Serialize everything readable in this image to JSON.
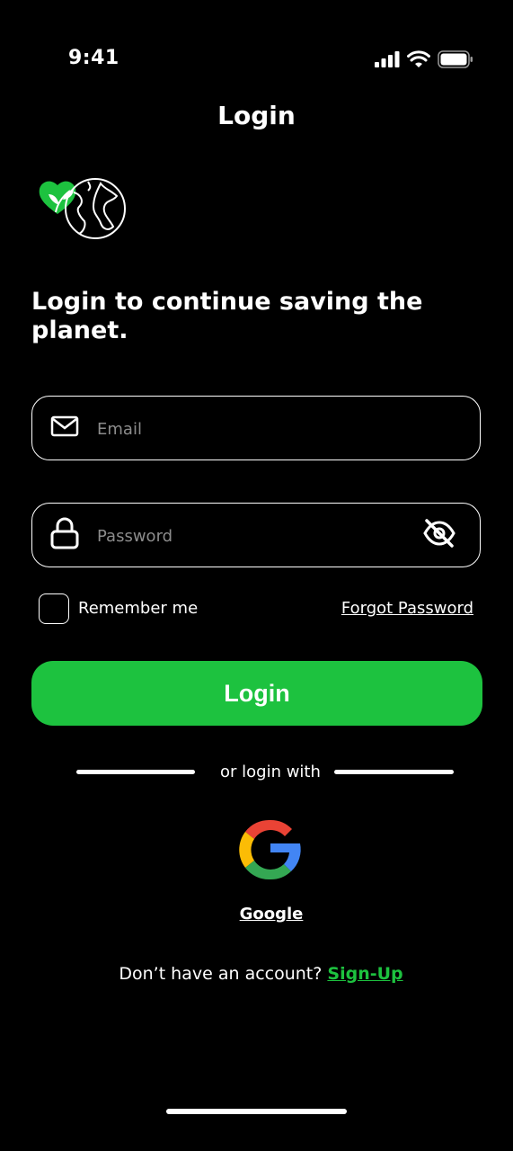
{
  "status_bar": {
    "time": "9:41"
  },
  "header": {
    "title": "Login"
  },
  "headline": "Login to continue saving the planet.",
  "email": {
    "placeholder": "Email",
    "value": ""
  },
  "password": {
    "placeholder": "Password",
    "value": ""
  },
  "remember": {
    "label": "Remember me",
    "checked": false
  },
  "forgot_label": "Forgot Password",
  "login_button_label": "Login",
  "divider_text": "or login with",
  "google_label": "Google",
  "signup": {
    "prompt": "Don’t have an account? ",
    "link_label": "Sign-Up"
  },
  "colors": {
    "accent": "#1DC23F",
    "background": "#000000",
    "text": "#FFFFFF"
  },
  "icons": [
    "signal-icon",
    "wifi-icon",
    "battery-icon",
    "heart-leaf-icon",
    "globe-icon",
    "mail-icon",
    "lock-icon",
    "eye-off-icon",
    "google-icon"
  ]
}
